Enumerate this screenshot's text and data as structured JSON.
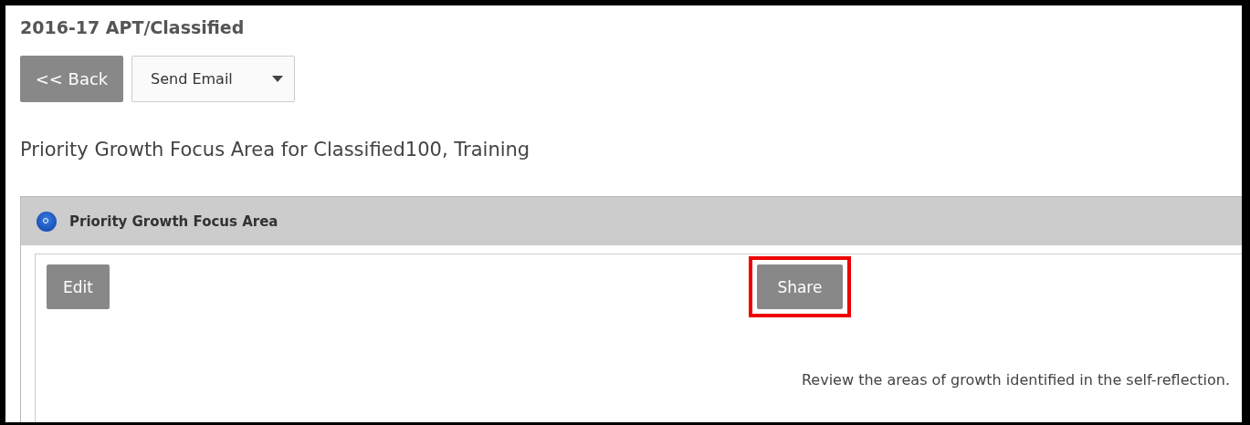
{
  "page_title": "2016-17 APT/Classified",
  "toolbar": {
    "back_button": "<< Back",
    "email_button": {
      "label": "Send Email",
      "has_dropdown": true
    }
  },
  "heading": "Priority Growth Focus Area for Classified100, Training",
  "panel": {
    "title": "Priority Growth Focus Area",
    "buttons": [
      {
        "label": "Edit",
        "highlighted": false
      },
      {
        "label": "Share",
        "highlighted": true
      }
    ],
    "instruction": "Review the areas of growth identified in the self-reflection."
  }
}
